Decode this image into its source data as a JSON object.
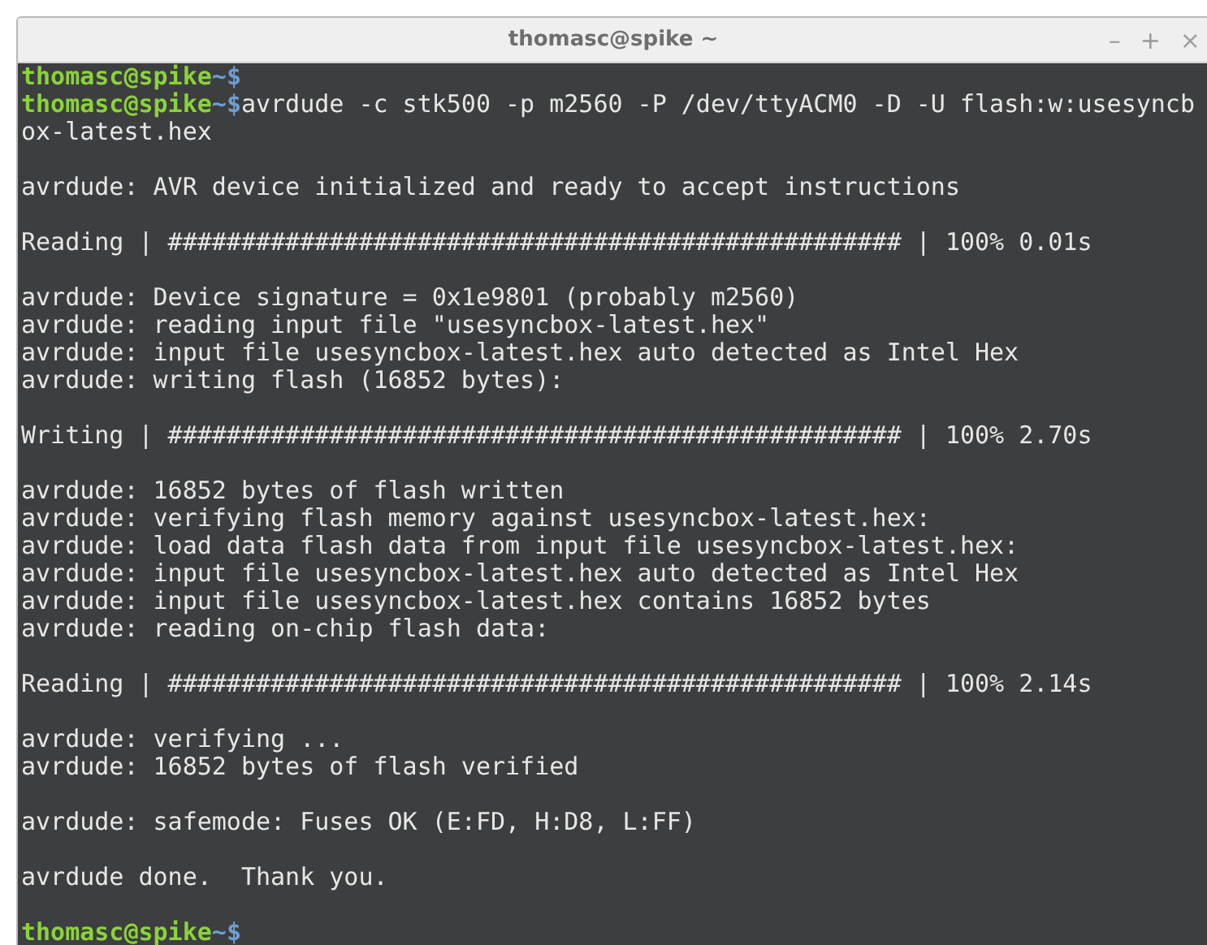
{
  "window": {
    "title": "thomasc@spike ~",
    "controls": [
      {
        "kind": "minimize",
        "label": "–"
      },
      {
        "kind": "maximize",
        "label": "+"
      },
      {
        "kind": "close",
        "label": "×"
      }
    ]
  },
  "terminal": {
    "lines": [
      {
        "kind": "prompt",
        "user": "thomasc@spike",
        "path": "~",
        "symbol": "$"
      },
      {
        "kind": "prompt",
        "user": "thomasc@spike",
        "path": "~",
        "symbol": "$",
        "command": "avrdude -c stk500 -p m2560 -P /dev/ttyACM0 -D -U flash:w:usesyncbox-latest.hex"
      },
      {
        "kind": "blank"
      },
      {
        "kind": "output",
        "text": "avrdude: AVR device initialized and ready to accept instructions"
      },
      {
        "kind": "blank"
      },
      {
        "kind": "output",
        "text": "Reading | ################################################## | 100% 0.01s"
      },
      {
        "kind": "blank"
      },
      {
        "kind": "output",
        "text": "avrdude: Device signature = 0x1e9801 (probably m2560)"
      },
      {
        "kind": "output",
        "text": "avrdude: reading input file \"usesyncbox-latest.hex\""
      },
      {
        "kind": "output",
        "text": "avrdude: input file usesyncbox-latest.hex auto detected as Intel Hex"
      },
      {
        "kind": "output",
        "text": "avrdude: writing flash (16852 bytes):"
      },
      {
        "kind": "blank"
      },
      {
        "kind": "output",
        "text": "Writing | ################################################## | 100% 2.70s"
      },
      {
        "kind": "blank"
      },
      {
        "kind": "output",
        "text": "avrdude: 16852 bytes of flash written"
      },
      {
        "kind": "output",
        "text": "avrdude: verifying flash memory against usesyncbox-latest.hex:"
      },
      {
        "kind": "output",
        "text": "avrdude: load data flash data from input file usesyncbox-latest.hex:"
      },
      {
        "kind": "output",
        "text": "avrdude: input file usesyncbox-latest.hex auto detected as Intel Hex"
      },
      {
        "kind": "output",
        "text": "avrdude: input file usesyncbox-latest.hex contains 16852 bytes"
      },
      {
        "kind": "output",
        "text": "avrdude: reading on-chip flash data:"
      },
      {
        "kind": "blank"
      },
      {
        "kind": "output",
        "text": "Reading | ################################################## | 100% 2.14s"
      },
      {
        "kind": "blank"
      },
      {
        "kind": "output",
        "text": "avrdude: verifying ..."
      },
      {
        "kind": "output",
        "text": "avrdude: 16852 bytes of flash verified"
      },
      {
        "kind": "blank"
      },
      {
        "kind": "output",
        "text": "avrdude: safemode: Fuses OK (E:FD, H:D8, L:FF)"
      },
      {
        "kind": "blank"
      },
      {
        "kind": "output",
        "text": "avrdude done.  Thank you."
      },
      {
        "kind": "blank"
      },
      {
        "kind": "prompt",
        "user": "thomasc@spike",
        "path": "~",
        "symbol": "$"
      }
    ]
  }
}
